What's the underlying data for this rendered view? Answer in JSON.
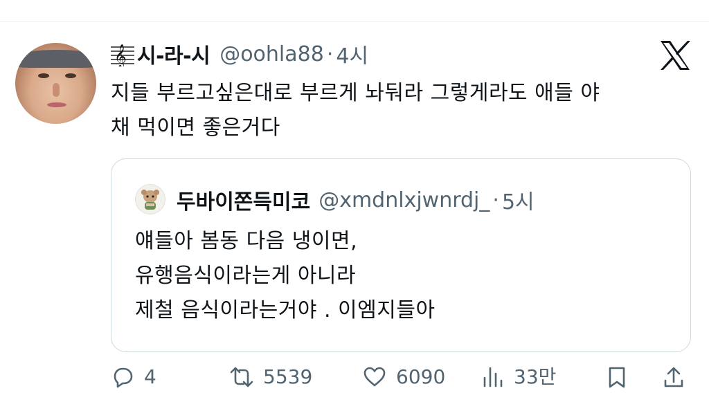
{
  "author": {
    "name": "시-라-시",
    "handle": "@oohla88",
    "separator": "·",
    "time": "4시",
    "name_icon": "music-staff-icon",
    "avatar_icon": "user-avatar"
  },
  "tweet_text": [
    "지들 부르고싶은대로 부르게 놔둬라 그렇게라도 애들 야",
    "채 먹이면 좋은거다"
  ],
  "platform_logo": "x-logo-icon",
  "quote": {
    "name": "두바이쫀득미코",
    "handle": "@xmdnlxjwnrdj_",
    "separator": "·",
    "time": "5시",
    "avatar_icon": "cartoon-character-avatar",
    "lines": [
      "얘들아 봄동 다음 냉이면,",
      "유행음식이라는게 아니라",
      "제철 음식이라는거야 . 이엠지들아"
    ]
  },
  "actions": {
    "reply": {
      "icon": "reply-icon",
      "count": "4"
    },
    "retweet": {
      "icon": "retweet-icon",
      "count": "5539"
    },
    "like": {
      "icon": "heart-icon",
      "count": "6090"
    },
    "views": {
      "icon": "views-icon",
      "count": "33만"
    },
    "bookmark": {
      "icon": "bookmark-icon"
    },
    "share": {
      "icon": "share-icon"
    }
  },
  "colors": {
    "text": "#0f1419",
    "secondary": "#536471",
    "border": "#cfd9de"
  }
}
